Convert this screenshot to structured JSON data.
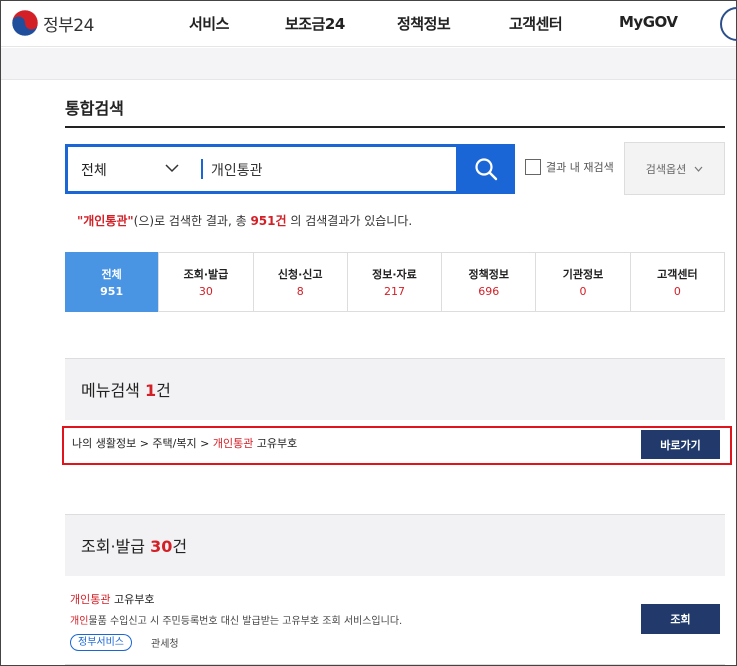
{
  "header": {
    "logo_text": "정부24",
    "nav": [
      "서비스",
      "보조금24",
      "정책정보",
      "고객센터",
      "MyGOV"
    ]
  },
  "page_title": "통합검색",
  "search": {
    "scope": "전체",
    "query": "개인통관",
    "research_label": "결과 내 재검색",
    "options_label": "검색옵션"
  },
  "result_msg": {
    "query_quoted": "\"개인통관\"",
    "mid": "(으)로 검색한 결과, 총 ",
    "total": "951건",
    "tail": " 의 검색결과가 있습니다."
  },
  "tabs": [
    {
      "label": "전체",
      "count": "951"
    },
    {
      "label": "조회·발급",
      "count": "30"
    },
    {
      "label": "신청·신고",
      "count": "8"
    },
    {
      "label": "정보·자료",
      "count": "217"
    },
    {
      "label": "정책정보",
      "count": "696"
    },
    {
      "label": "기관정보",
      "count": "0"
    },
    {
      "label": "고객센터",
      "count": "0"
    }
  ],
  "menu_section": {
    "title": "메뉴검색",
    "count": "1",
    "unit": "건",
    "breadcrumb_pre": "나의 생활정보 > 주택/복지 > ",
    "breadcrumb_hl": "개인통관",
    "breadcrumb_post": " 고유부호",
    "button": "바로가기"
  },
  "issue_section": {
    "title": "조회·발급",
    "count": "30",
    "unit": "건",
    "result_title_hl": "개인통관",
    "result_title_post": " 고유부호",
    "desc_hl": "개인",
    "desc_post": "물품 수입신고 시 주민등록번호 대신 발급받는 고유부호 조회 서비스입니다.",
    "tag": "정부서비스",
    "agency": "관세청",
    "button": "조회"
  },
  "colors": {
    "primary_blue": "#1a66d6",
    "tab_active": "#4a95e3",
    "highlight_red": "#d32027",
    "button_navy": "#213a6b"
  }
}
